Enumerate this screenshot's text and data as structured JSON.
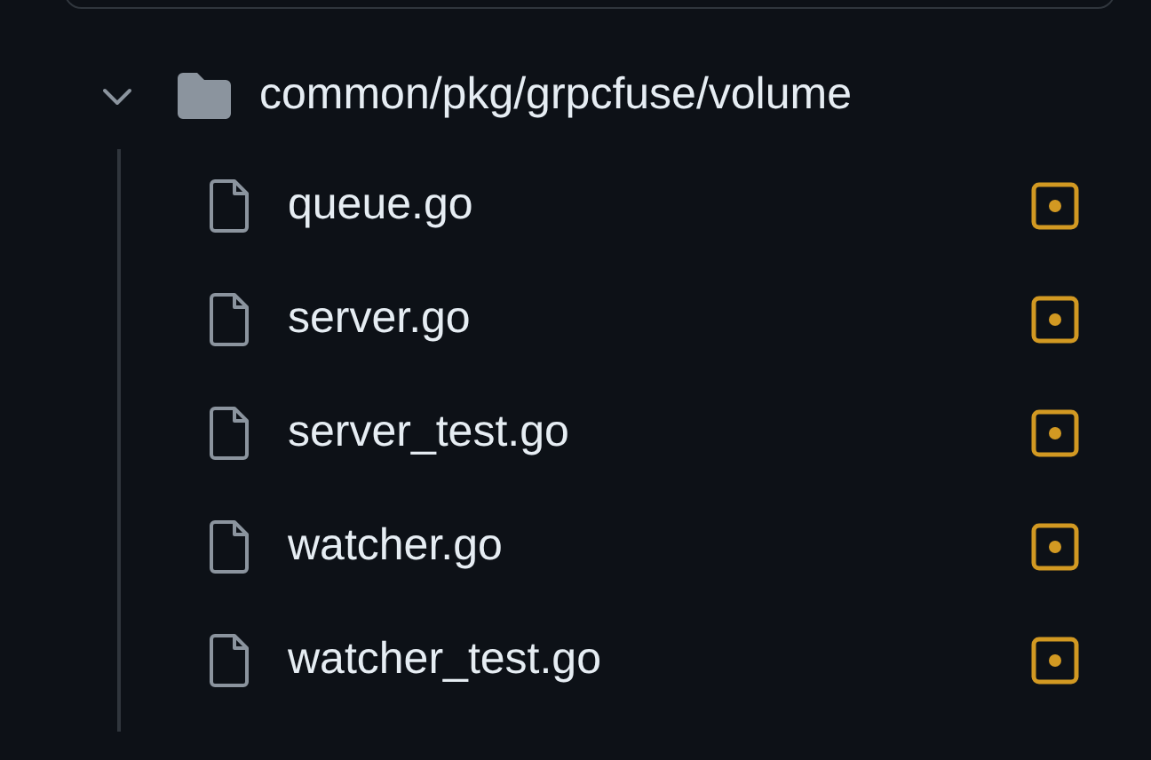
{
  "folder": {
    "name": "common/pkg/grpcfuse/volume",
    "expanded": true,
    "files": [
      {
        "name": "queue.go",
        "kind": "modified"
      },
      {
        "name": "server.go",
        "kind": "modified"
      },
      {
        "name": "server_test.go",
        "kind": "modified"
      },
      {
        "name": "watcher.go",
        "kind": "modified"
      },
      {
        "name": "watcher_test.go",
        "kind": "modified"
      }
    ]
  }
}
